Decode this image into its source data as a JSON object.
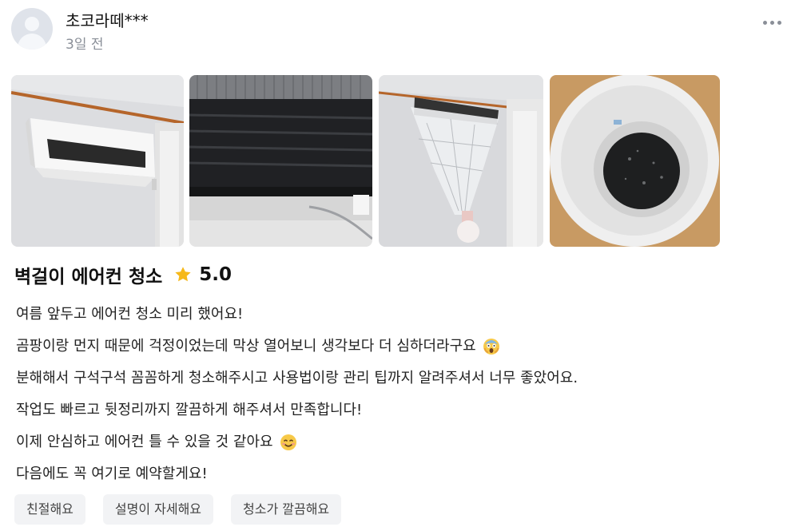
{
  "review": {
    "username": "초코라떼***",
    "timestamp": "3일 전",
    "title": "벽걸이 에어컨 청소",
    "rating": "5.0",
    "lines": [
      "여름 앞두고 에어컨 청소 미리 했어요!",
      "곰팡이랑 먼지 때문에 걱정이었는데 막상 열어보니 생각보다 더 심하더라구요",
      "분해해서 구석구석 꼼꼼하게 청소해주시고 사용법이랑 관리 팁까지 알려주셔서 너무 좋았어요.",
      "작업도 빠르고 뒷정리까지 깔끔하게 해주셔서 만족합니다!",
      "이제 안심하고 에어컨 틀 수 있을 것 같아요",
      "다음에도 꼭 여기로 예약할게요!"
    ],
    "tags": [
      "친절해요",
      "설명이 자세해요",
      "청소가 깔끔해요"
    ]
  },
  "photos": [
    {
      "icon": "wall-air-conditioner-photo"
    },
    {
      "icon": "disassembled-ac-fan-photo"
    },
    {
      "icon": "ac-cleaning-cover-photo"
    },
    {
      "icon": "dirty-water-bucket-photo"
    }
  ],
  "icons": {
    "more": "more-options-icon",
    "star": "star-icon",
    "emoji_shocked": "screaming-face-emoji",
    "emoji_smile": "smiling-face-emoji"
  },
  "colors": {
    "star": "#f6b91b",
    "muted_text": "#8a8f98",
    "tag_background": "#f2f3f5"
  }
}
